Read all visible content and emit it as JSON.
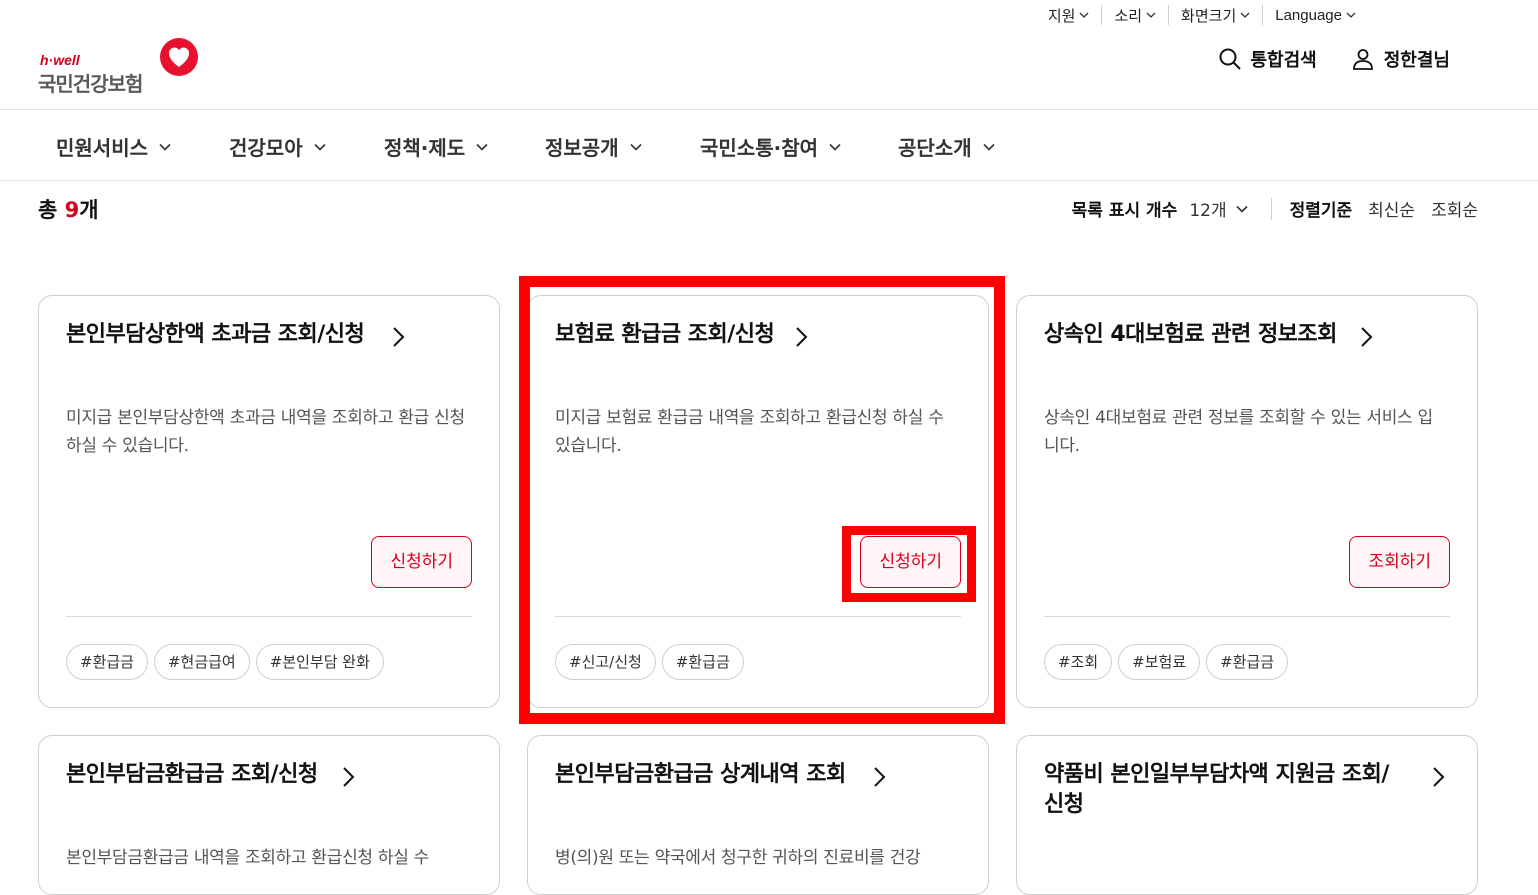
{
  "util_bar": [
    {
      "label": "지원"
    },
    {
      "label": "소리"
    },
    {
      "label": "화면크기"
    },
    {
      "label": "Language"
    }
  ],
  "header": {
    "logo_sub": "h·well",
    "logo_main": "국민건강보험",
    "search_label": "통합검색",
    "user_label": "정한결님"
  },
  "gnb": [
    {
      "label": "민원서비스"
    },
    {
      "label": "건강모아"
    },
    {
      "label": "정책·제도"
    },
    {
      "label": "정보공개"
    },
    {
      "label": "국민소통·참여"
    },
    {
      "label": "공단소개"
    }
  ],
  "list": {
    "total_prefix": "총 ",
    "total_count": "9",
    "total_suffix": "개",
    "display_count_label": "목록 표시 개수",
    "display_count_value": "12개",
    "sort_label": "정렬기준",
    "sort_options": [
      "최신순",
      "조회순"
    ]
  },
  "cards": [
    {
      "title": "본인부담상한액 초과금 조회/신청",
      "desc": "미지급 본인부담상한액 초과금 내역을 조회하고 환급 신청 하실 수 있습니다.",
      "button": "신청하기",
      "tags": [
        "#환급금",
        "#현금급여",
        "#본인부담 완화"
      ]
    },
    {
      "title": "보험료 환급금 조회/신청",
      "desc": "미지급 보험료 환급금 내역을 조회하고 환급신청 하실 수 있습니다.",
      "button": "신청하기",
      "tags": [
        "#신고/신청",
        "#환급금"
      ]
    },
    {
      "title": "상속인 4대보험료 관련 정보조회",
      "desc": "상속인 4대보험료 관련 정보를 조회할 수 있는 서비스 입니다.",
      "button": "조회하기",
      "tags": [
        "#조회",
        "#보험료",
        "#환급금"
      ]
    },
    {
      "title": "본인부담금환급금 조회/신청",
      "desc": "본인부담금환급금 내역을 조회하고 환급신청 하실 수",
      "button": "",
      "tags": []
    },
    {
      "title": "본인부담금환급금 상계내역 조회",
      "desc": "병(의)원 또는 약국에서 청구한 귀하의 진료비를 건강",
      "button": "",
      "tags": []
    },
    {
      "title": "약품비 본인일부부담차액 지원금 조회/신청",
      "desc": "",
      "button": "",
      "tags": []
    }
  ],
  "colors": {
    "accent": "#d4001f",
    "highlight": "#ff0000"
  }
}
